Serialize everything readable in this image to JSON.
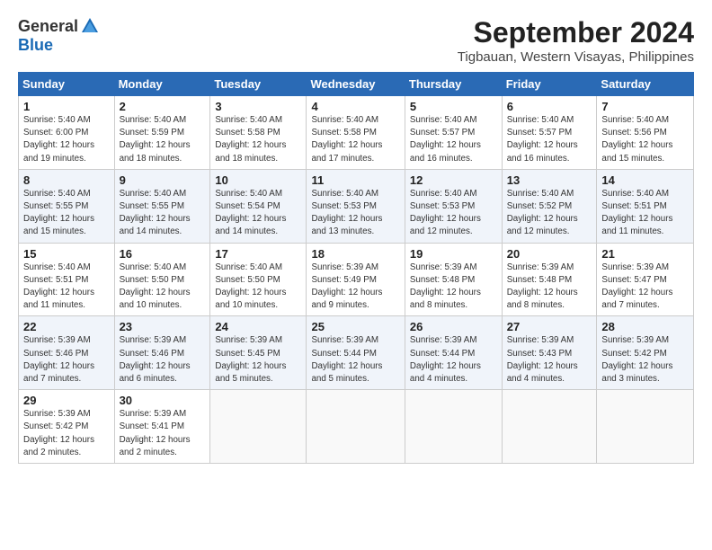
{
  "header": {
    "logo_general": "General",
    "logo_blue": "Blue",
    "month": "September 2024",
    "location": "Tigbauan, Western Visayas, Philippines"
  },
  "weekdays": [
    "Sunday",
    "Monday",
    "Tuesday",
    "Wednesday",
    "Thursday",
    "Friday",
    "Saturday"
  ],
  "weeks": [
    [
      {
        "day": "1",
        "info": "Sunrise: 5:40 AM\nSunset: 6:00 PM\nDaylight: 12 hours\nand 19 minutes."
      },
      {
        "day": "2",
        "info": "Sunrise: 5:40 AM\nSunset: 5:59 PM\nDaylight: 12 hours\nand 18 minutes."
      },
      {
        "day": "3",
        "info": "Sunrise: 5:40 AM\nSunset: 5:58 PM\nDaylight: 12 hours\nand 18 minutes."
      },
      {
        "day": "4",
        "info": "Sunrise: 5:40 AM\nSunset: 5:58 PM\nDaylight: 12 hours\nand 17 minutes."
      },
      {
        "day": "5",
        "info": "Sunrise: 5:40 AM\nSunset: 5:57 PM\nDaylight: 12 hours\nand 16 minutes."
      },
      {
        "day": "6",
        "info": "Sunrise: 5:40 AM\nSunset: 5:57 PM\nDaylight: 12 hours\nand 16 minutes."
      },
      {
        "day": "7",
        "info": "Sunrise: 5:40 AM\nSunset: 5:56 PM\nDaylight: 12 hours\nand 15 minutes."
      }
    ],
    [
      {
        "day": "8",
        "info": "Sunrise: 5:40 AM\nSunset: 5:55 PM\nDaylight: 12 hours\nand 15 minutes."
      },
      {
        "day": "9",
        "info": "Sunrise: 5:40 AM\nSunset: 5:55 PM\nDaylight: 12 hours\nand 14 minutes."
      },
      {
        "day": "10",
        "info": "Sunrise: 5:40 AM\nSunset: 5:54 PM\nDaylight: 12 hours\nand 14 minutes."
      },
      {
        "day": "11",
        "info": "Sunrise: 5:40 AM\nSunset: 5:53 PM\nDaylight: 12 hours\nand 13 minutes."
      },
      {
        "day": "12",
        "info": "Sunrise: 5:40 AM\nSunset: 5:53 PM\nDaylight: 12 hours\nand 12 minutes."
      },
      {
        "day": "13",
        "info": "Sunrise: 5:40 AM\nSunset: 5:52 PM\nDaylight: 12 hours\nand 12 minutes."
      },
      {
        "day": "14",
        "info": "Sunrise: 5:40 AM\nSunset: 5:51 PM\nDaylight: 12 hours\nand 11 minutes."
      }
    ],
    [
      {
        "day": "15",
        "info": "Sunrise: 5:40 AM\nSunset: 5:51 PM\nDaylight: 12 hours\nand 11 minutes."
      },
      {
        "day": "16",
        "info": "Sunrise: 5:40 AM\nSunset: 5:50 PM\nDaylight: 12 hours\nand 10 minutes."
      },
      {
        "day": "17",
        "info": "Sunrise: 5:40 AM\nSunset: 5:50 PM\nDaylight: 12 hours\nand 10 minutes."
      },
      {
        "day": "18",
        "info": "Sunrise: 5:39 AM\nSunset: 5:49 PM\nDaylight: 12 hours\nand 9 minutes."
      },
      {
        "day": "19",
        "info": "Sunrise: 5:39 AM\nSunset: 5:48 PM\nDaylight: 12 hours\nand 8 minutes."
      },
      {
        "day": "20",
        "info": "Sunrise: 5:39 AM\nSunset: 5:48 PM\nDaylight: 12 hours\nand 8 minutes."
      },
      {
        "day": "21",
        "info": "Sunrise: 5:39 AM\nSunset: 5:47 PM\nDaylight: 12 hours\nand 7 minutes."
      }
    ],
    [
      {
        "day": "22",
        "info": "Sunrise: 5:39 AM\nSunset: 5:46 PM\nDaylight: 12 hours\nand 7 minutes."
      },
      {
        "day": "23",
        "info": "Sunrise: 5:39 AM\nSunset: 5:46 PM\nDaylight: 12 hours\nand 6 minutes."
      },
      {
        "day": "24",
        "info": "Sunrise: 5:39 AM\nSunset: 5:45 PM\nDaylight: 12 hours\nand 5 minutes."
      },
      {
        "day": "25",
        "info": "Sunrise: 5:39 AM\nSunset: 5:44 PM\nDaylight: 12 hours\nand 5 minutes."
      },
      {
        "day": "26",
        "info": "Sunrise: 5:39 AM\nSunset: 5:44 PM\nDaylight: 12 hours\nand 4 minutes."
      },
      {
        "day": "27",
        "info": "Sunrise: 5:39 AM\nSunset: 5:43 PM\nDaylight: 12 hours\nand 4 minutes."
      },
      {
        "day": "28",
        "info": "Sunrise: 5:39 AM\nSunset: 5:42 PM\nDaylight: 12 hours\nand 3 minutes."
      }
    ],
    [
      {
        "day": "29",
        "info": "Sunrise: 5:39 AM\nSunset: 5:42 PM\nDaylight: 12 hours\nand 2 minutes."
      },
      {
        "day": "30",
        "info": "Sunrise: 5:39 AM\nSunset: 5:41 PM\nDaylight: 12 hours\nand 2 minutes."
      },
      {
        "day": "",
        "info": ""
      },
      {
        "day": "",
        "info": ""
      },
      {
        "day": "",
        "info": ""
      },
      {
        "day": "",
        "info": ""
      },
      {
        "day": "",
        "info": ""
      }
    ]
  ]
}
